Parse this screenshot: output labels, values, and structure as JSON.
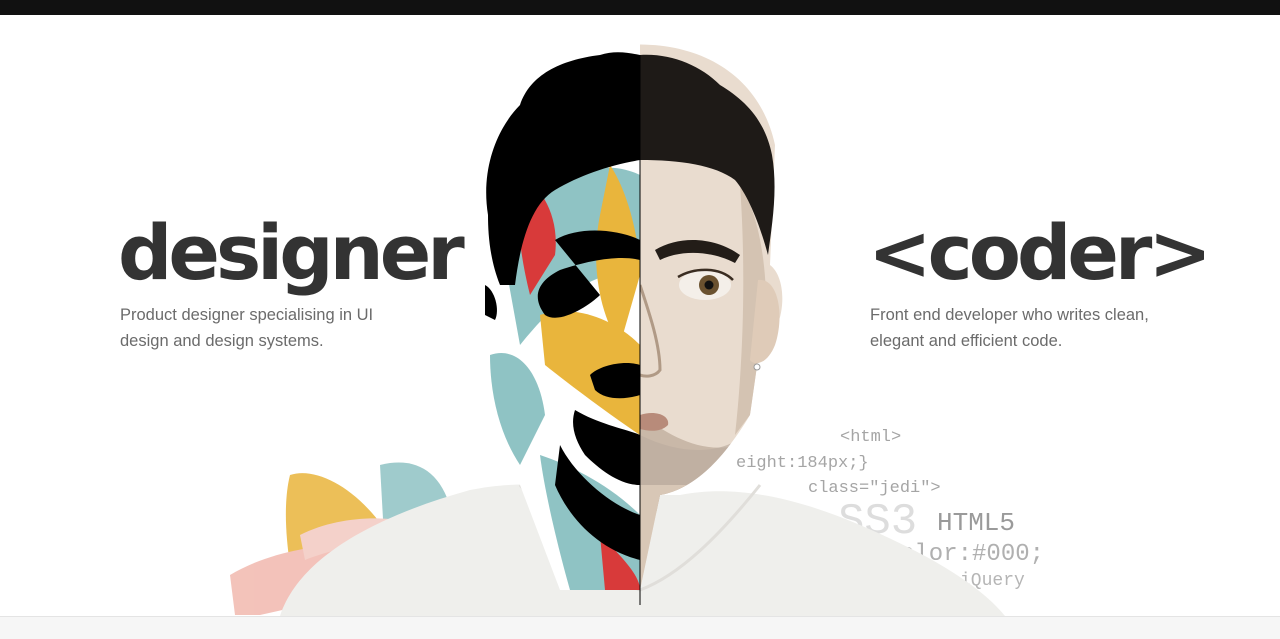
{
  "designer": {
    "title": "designer",
    "description": "Product designer specialising in UI design and design systems."
  },
  "coder": {
    "title": "<coder>",
    "description": "Front end developer who writes clean, elegant and efficient code."
  },
  "code_words": [
    "<html>",
    "eight:184px;}",
    "class=\"jedi\">",
    "SS3",
    "HTML5",
    "olor:#000;",
    "iQuery"
  ],
  "colors": {
    "top_bar": "#111111",
    "heading": "#333333",
    "body_text": "#6b6b6b",
    "code_text": "#a5a5a5",
    "paint_red": "#d83a3a",
    "paint_teal": "#8fc3c4",
    "paint_yellow": "#e9b53c",
    "paint_pink": "#f1b8ae"
  }
}
